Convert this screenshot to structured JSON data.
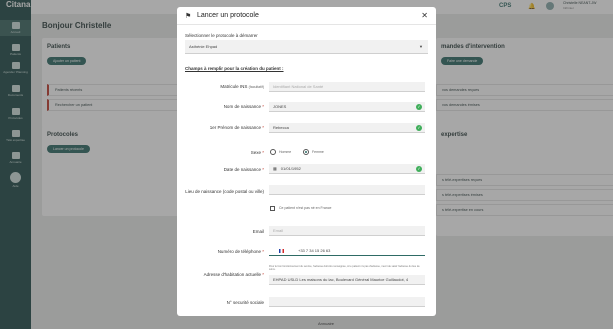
{
  "app": {
    "logo": "Citana"
  },
  "sidebar": {
    "items": [
      {
        "label": "Accueil"
      },
      {
        "label": "Patients"
      },
      {
        "label": "Agenda / Planning"
      },
      {
        "label": "Documents"
      },
      {
        "label": "Protocoles"
      },
      {
        "label": "Télé expertise"
      },
      {
        "label": "Annuaire"
      },
      {
        "label": "Aide"
      }
    ]
  },
  "topbar": {
    "cps": "CPS",
    "user_name": "Christelle NEANT-JW",
    "user_role": "Infirmier"
  },
  "main": {
    "greeting": "Bonjour Christelle",
    "patients": {
      "title": "Patients",
      "add_label": "Ajouter un patient",
      "rows": [
        "Patients récents",
        "Rechercher un patient"
      ]
    },
    "protocoles": {
      "title": "Protocoles",
      "launch_label": "Lancer un protocole"
    },
    "demandes": {
      "title": "mandes d'intervention",
      "action_label": "Faire une demande",
      "rows": [
        "vos demandes reçues",
        "vos demandes émises"
      ]
    },
    "expertise": {
      "title": "expertise",
      "rows": [
        "s télé-expertises reçues",
        "s télé-expertises émises",
        "s télé-expertise en cours"
      ]
    },
    "bottom_link": "Annuaire"
  },
  "modal": {
    "title": "Lancer un protocole",
    "select_label": "Sélectionner le protocole à démarrer",
    "select_value": "Asthénie Ehpad",
    "section_link": "Champs à remplir pour la création du patient :",
    "fields": {
      "ins_label": "Matricule INS",
      "ins_suffix": "(facultatif)",
      "ins_placeholder": "Identifiant National de Santé",
      "nom_label": "Nom de naissance",
      "nom_value": "JONES",
      "prenom_label": "1er Prénom de naissance",
      "prenom_value": "Rebecca",
      "sexe_label": "Sexe",
      "sexe_options": [
        "Homme",
        "Femme"
      ],
      "date_label": "Date de naissance",
      "date_value": "01/01/1952",
      "lieu_label": "Lieu de naissance (code postal ou ville)",
      "lieu_checkbox": "Ce patient n'est pas né en France",
      "email_label": "Email",
      "email_placeholder": "Email",
      "tel_label": "Numéro de téléphone",
      "tel_value": "+33 7 34 15 26 63",
      "adresse_label": "Adresse d'habitation actuelle",
      "adresse_note": "Pour le bon fonctionnement du service, l'adresse doit être renseignée, si le patient n'a pas d'adresse, merci de saisir l'adresse du lieu de soins.",
      "adresse_value": "EHPAD USLD Les maisons du lac, Boulevard Général Maurice Guillaudot, 4",
      "secu_label": "N° securité sociale"
    }
  },
  "colors": {
    "primary": "#2e6b65",
    "sidebar": "#1f4a47",
    "success": "#3fae5a",
    "required": "#c0392b"
  }
}
